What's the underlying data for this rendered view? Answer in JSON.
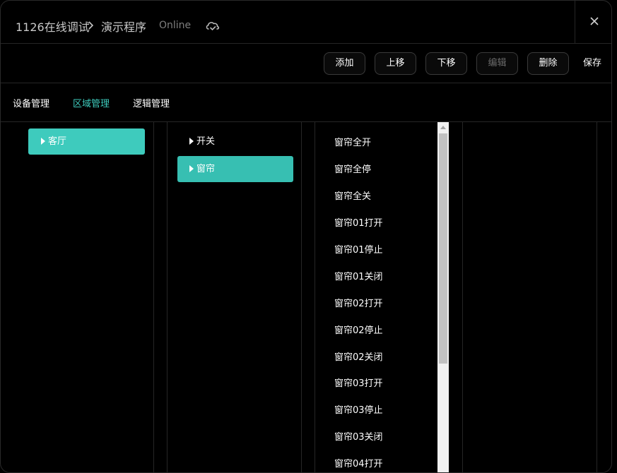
{
  "titlebar": {
    "project": "1126在线调试",
    "program": "演示程序",
    "status": "Online"
  },
  "toolbar": {
    "add": "添加",
    "move_up": "上移",
    "move_down": "下移",
    "edit": "编辑",
    "delete": "删除",
    "save": "保存"
  },
  "tabs": {
    "device": "设备管理",
    "area": "区域管理",
    "logic": "逻辑管理"
  },
  "areas": {
    "room": "客厅"
  },
  "groups": {
    "switch": "开关",
    "curtain": "窗帘"
  },
  "commands": [
    "窗帘全开",
    "窗帘全停",
    "窗帘全关",
    "窗帘01打开",
    "窗帘01停止",
    "窗帘01关闭",
    "窗帘02打开",
    "窗帘02停止",
    "窗帘02关闭",
    "窗帘03打开",
    "窗帘03停止",
    "窗帘03关闭",
    "窗帘04打开"
  ],
  "colors": {
    "accent": "#3ecbbd",
    "background": "#000000"
  }
}
